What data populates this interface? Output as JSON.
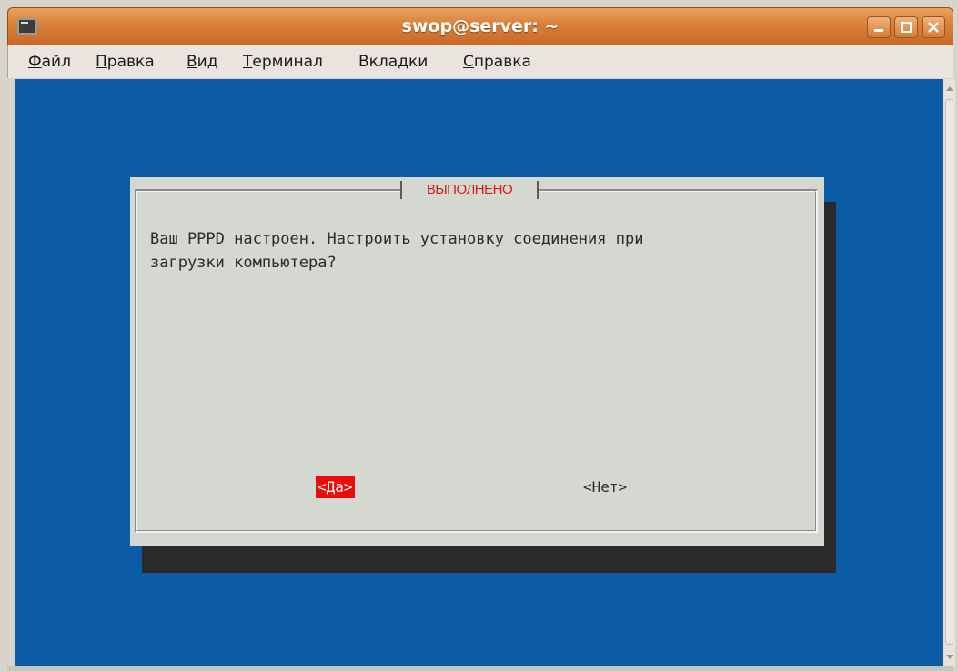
{
  "window": {
    "title": "swop@server: ~"
  },
  "menu": {
    "items": [
      {
        "label": "Файл"
      },
      {
        "label": "Правка"
      },
      {
        "label": "Вид"
      },
      {
        "label": "Терминал"
      },
      {
        "label": "Вкладки"
      },
      {
        "label": "Справка"
      }
    ]
  },
  "dialog": {
    "title": "ВЫПОЛНЕНО",
    "message": "Ваш PPPD настроен. Настроить установку соединения при\nзагрузки компьютера?",
    "yes_label": "<Да>",
    "no_label": "<Нет>",
    "selected": "yes"
  },
  "colors": {
    "terminal_background": "#0b5ca4",
    "dialog_background": "#d4d8d0",
    "dialog_title": "#dd1a1a",
    "selected_button": "#ee0a0a",
    "titlebar": "#d9803a"
  }
}
